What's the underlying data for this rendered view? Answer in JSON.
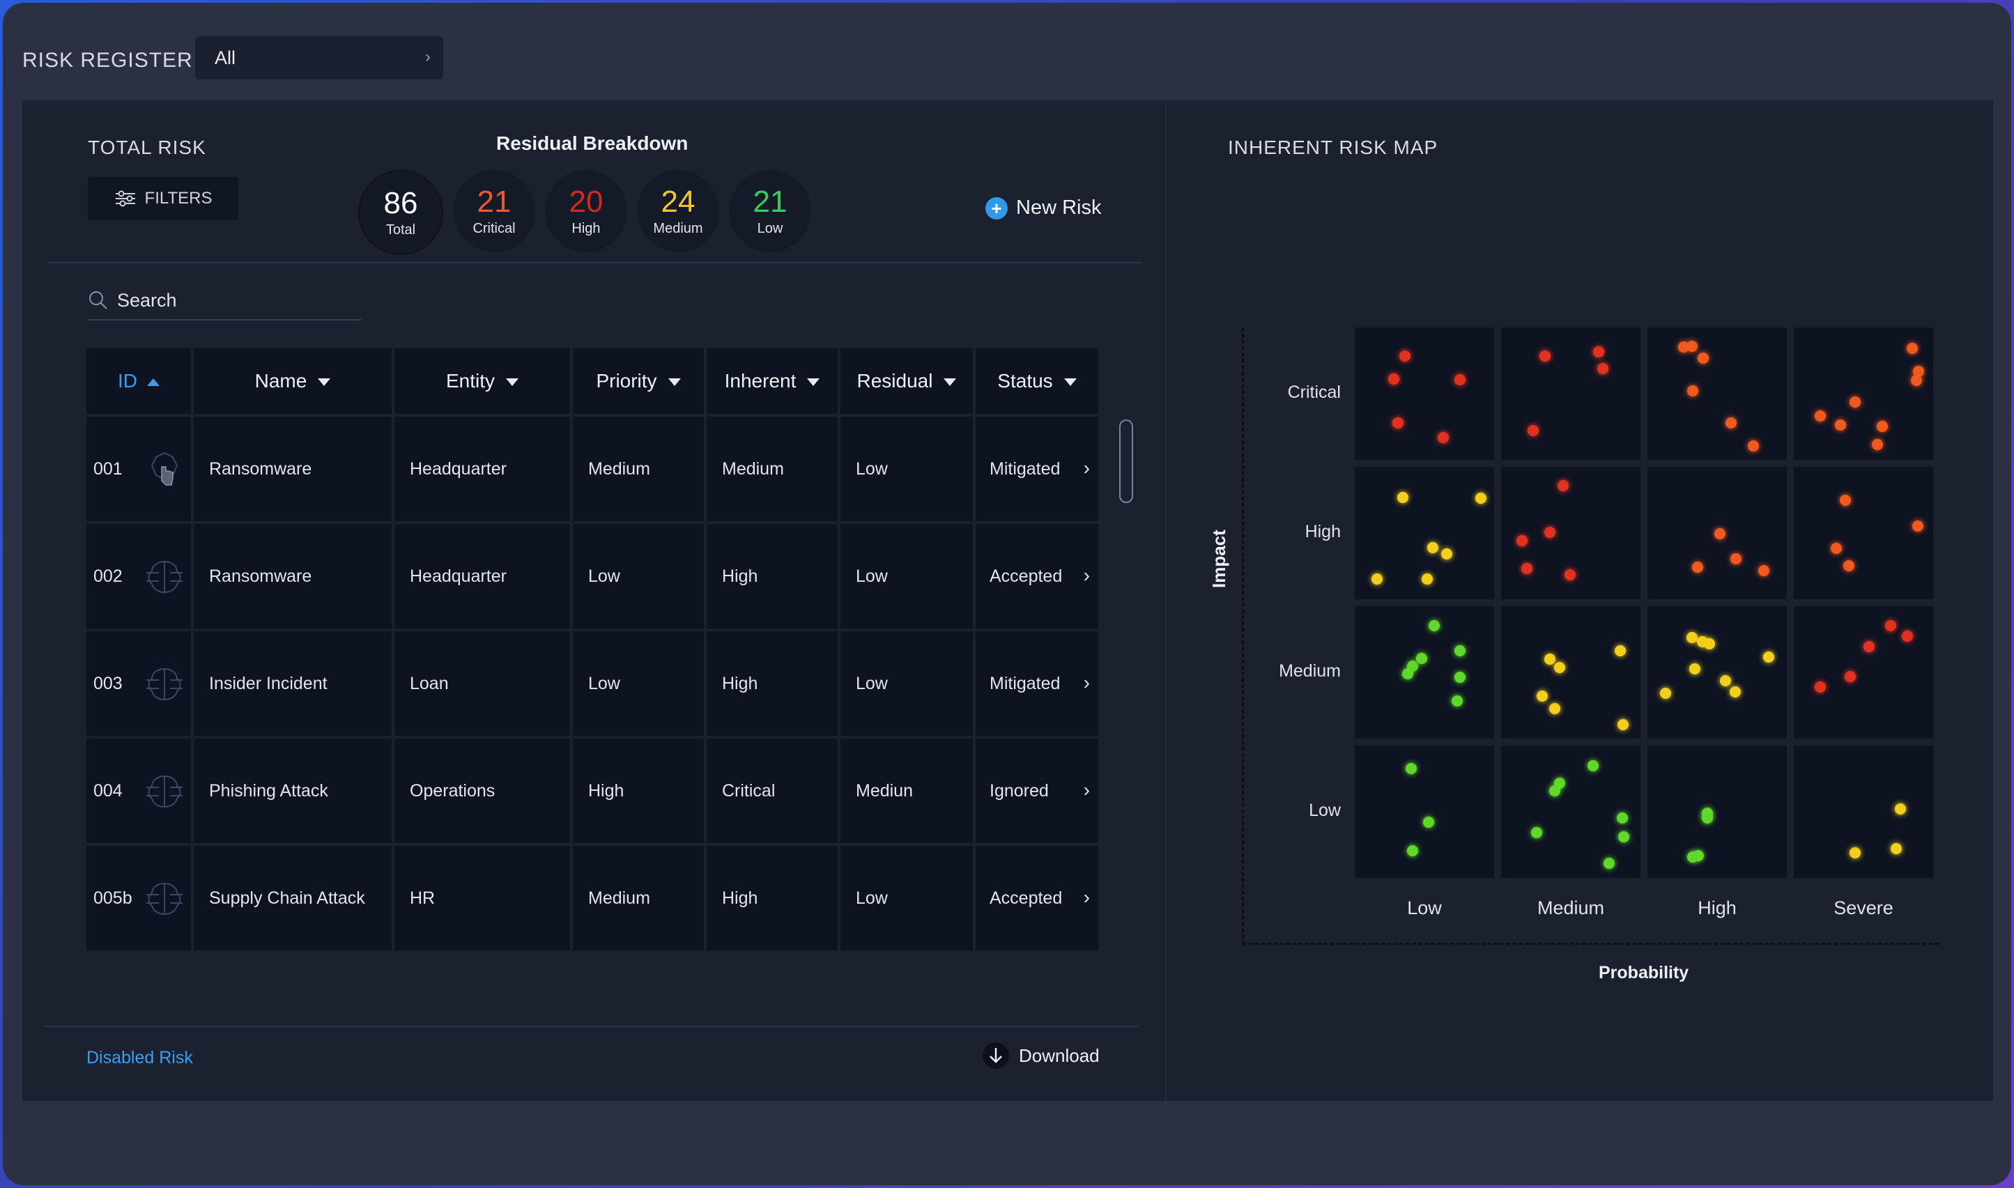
{
  "header": {
    "title": "RISK REGISTER",
    "scope_value": "All"
  },
  "summary": {
    "title": "TOTAL RISK",
    "filters_label": "FILTERS",
    "breakdown_title": "Residual Breakdown",
    "badges": [
      {
        "value": "86",
        "label": "Total",
        "color": "#ffffff"
      },
      {
        "value": "21",
        "label": "Critical",
        "color": "#ef5a2a"
      },
      {
        "value": "20",
        "label": "High",
        "color": "#d8261c"
      },
      {
        "value": "24",
        "label": "Medium",
        "color": "#f0c62c"
      },
      {
        "value": "21",
        "label": "Low",
        "color": "#35d05a"
      }
    ],
    "new_risk_label": "New Risk"
  },
  "search": {
    "placeholder": "Search"
  },
  "table": {
    "columns": [
      "ID",
      "Name",
      "Entity",
      "Priority",
      "Inherent",
      "Residual",
      "Status"
    ],
    "rows": [
      {
        "id": "001",
        "icon": "hand-pointer-icon",
        "name": "Ransomware",
        "entity": "Headquarter",
        "priority": "Medium",
        "inherent": "Medium",
        "residual": "Low",
        "status": "Mitigated"
      },
      {
        "id": "002",
        "icon": "brain-circuit-icon",
        "name": "Ransomware",
        "entity": "Headquarter",
        "priority": "Low",
        "inherent": "High",
        "residual": "Low",
        "status": "Accepted"
      },
      {
        "id": "003",
        "icon": "brain-circuit-icon",
        "name": "Insider Incident",
        "entity": "Loan",
        "priority": "Low",
        "inherent": "High",
        "residual": "Low",
        "status": "Mitigated"
      },
      {
        "id": "004",
        "icon": "brain-circuit-icon",
        "name": "Phishing Attack",
        "entity": "Operations",
        "priority": "High",
        "inherent": "Critical",
        "residual": "Mediun",
        "status": "Ignored"
      },
      {
        "id": "005b",
        "icon": "brain-circuit-icon",
        "name": "Supply Chain Attack",
        "entity": "HR",
        "priority": "Medium",
        "inherent": "High",
        "residual": "Low",
        "status": "Accepted"
      }
    ]
  },
  "footer": {
    "disabled_risk_label": "Disabled Risk",
    "download_label": "Download"
  },
  "risk_map": {
    "title": "INHERENT RISK MAP",
    "y_axis_label": "Impact",
    "x_axis_label": "Probability",
    "impact_levels": [
      "Critical",
      "High",
      "Medium",
      "Low"
    ],
    "probability_levels": [
      "Low",
      "Medium",
      "High",
      "Severe"
    ],
    "dot_colors": {
      "red": "#e2311f",
      "orange": "#f05a1e",
      "yellow": "#f2cf1a",
      "green": "#5fd82a"
    },
    "cells": [
      {
        "impact": "Critical",
        "probability": "Low",
        "color": "red",
        "count": 5
      },
      {
        "impact": "Critical",
        "probability": "Medium",
        "color": "red",
        "count": 4
      },
      {
        "impact": "Critical",
        "probability": "High",
        "color": "orange",
        "count": 6
      },
      {
        "impact": "Critical",
        "probability": "Severe",
        "color": "orange",
        "count": 8
      },
      {
        "impact": "High",
        "probability": "Low",
        "color": "yellow",
        "count": 6
      },
      {
        "impact": "High",
        "probability": "Medium",
        "color": "red",
        "count": 5
      },
      {
        "impact": "High",
        "probability": "High",
        "color": "orange",
        "count": 4
      },
      {
        "impact": "High",
        "probability": "Severe",
        "color": "orange",
        "count": 4
      },
      {
        "impact": "Medium",
        "probability": "Low",
        "color": "green",
        "count": 7
      },
      {
        "impact": "Medium",
        "probability": "Medium",
        "color": "yellow",
        "count": 6
      },
      {
        "impact": "Medium",
        "probability": "High",
        "color": "yellow",
        "count": 8
      },
      {
        "impact": "Medium",
        "probability": "Severe",
        "color": "red",
        "count": 5
      },
      {
        "impact": "Low",
        "probability": "Low",
        "color": "green",
        "count": 3
      },
      {
        "impact": "Low",
        "probability": "Medium",
        "color": "green",
        "count": 7
      },
      {
        "impact": "Low",
        "probability": "High",
        "color": "green",
        "count": 4
      },
      {
        "impact": "Low",
        "probability": "Severe",
        "color": "yellow",
        "count": 3
      }
    ]
  }
}
